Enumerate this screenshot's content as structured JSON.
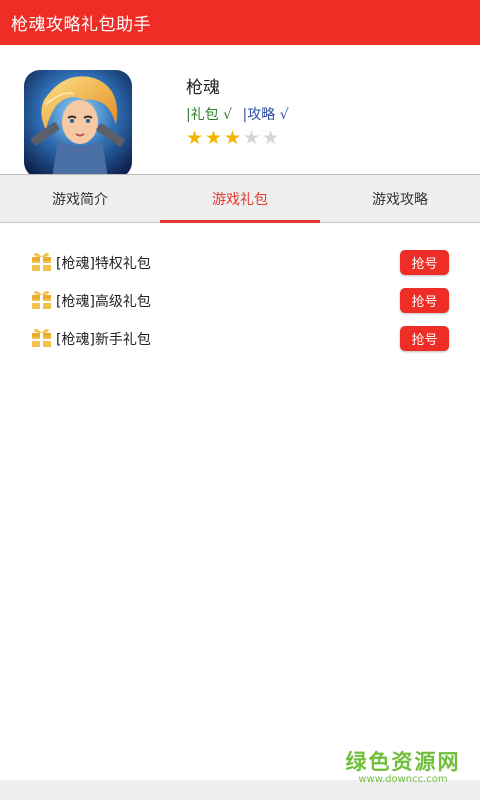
{
  "app": {
    "title": "枪魂攻略礼包助手",
    "accent": "#ee2d26"
  },
  "game": {
    "name": "枪魂",
    "tags": {
      "gift": "|礼包 √",
      "guide": "|攻略 √"
    },
    "rating": 3,
    "rating_max": 5
  },
  "tabs": [
    {
      "label": "游戏简介",
      "active": false
    },
    {
      "label": "游戏礼包",
      "active": true
    },
    {
      "label": "游戏攻略",
      "active": false
    }
  ],
  "gifts": [
    {
      "label": "[枪魂]特权礼包",
      "button": "抢号"
    },
    {
      "label": "[枪魂]高级礼包",
      "button": "抢号"
    },
    {
      "label": "[枪魂]新手礼包",
      "button": "抢号"
    }
  ],
  "watermark": {
    "main": "绿色资源网",
    "url": "www.downcc.com"
  }
}
